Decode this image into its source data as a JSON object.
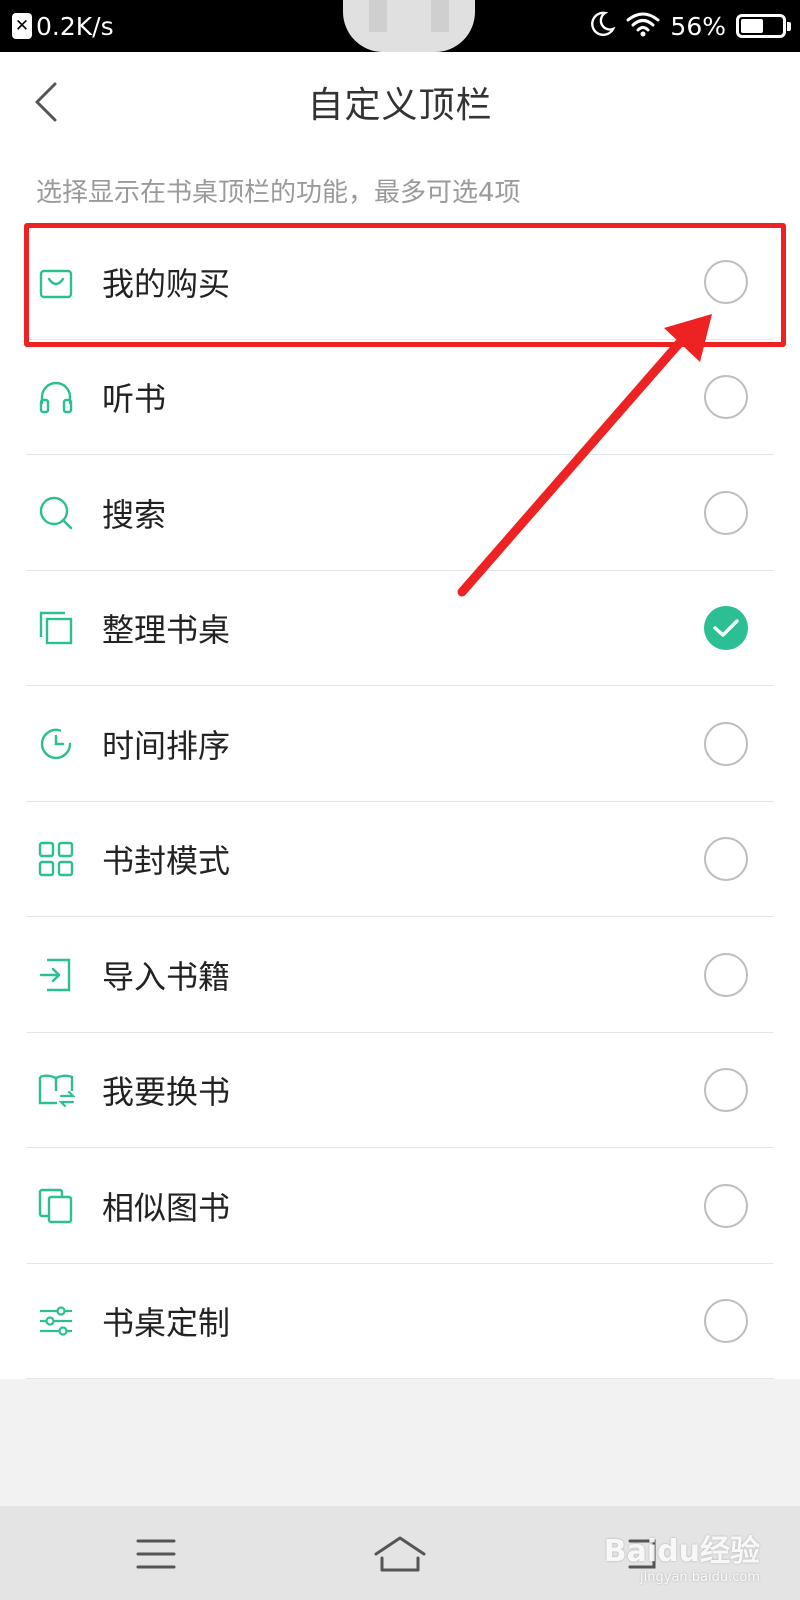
{
  "status_bar": {
    "net_speed": "0.2K/s",
    "battery_percent": "56%",
    "battery_level": 0.56
  },
  "header": {
    "title": "自定义顶栏",
    "back_icon": "chevron-left-icon"
  },
  "subtitle": "选择显示在书桌顶栏的功能，最多可选4项",
  "items": [
    {
      "label": "我的购买",
      "icon": "shopping-bag-icon",
      "checked": false
    },
    {
      "label": "听书",
      "icon": "headphones-icon",
      "checked": false
    },
    {
      "label": "搜索",
      "icon": "search-icon",
      "checked": false
    },
    {
      "label": "整理书桌",
      "icon": "organize-icon",
      "checked": true
    },
    {
      "label": "时间排序",
      "icon": "clock-icon",
      "checked": false
    },
    {
      "label": "书封模式",
      "icon": "grid-icon",
      "checked": false
    },
    {
      "label": "导入书籍",
      "icon": "import-icon",
      "checked": false
    },
    {
      "label": "我要换书",
      "icon": "exchange-book-icon",
      "checked": false
    },
    {
      "label": "相似图书",
      "icon": "similar-books-icon",
      "checked": false
    },
    {
      "label": "书桌定制",
      "icon": "sliders-icon",
      "checked": false
    }
  ],
  "colors": {
    "accent": "#2bbf93",
    "annotation": "#ee2222"
  },
  "watermark": {
    "brand": "Baidu经验",
    "url": "jingyan.baidu.com"
  }
}
